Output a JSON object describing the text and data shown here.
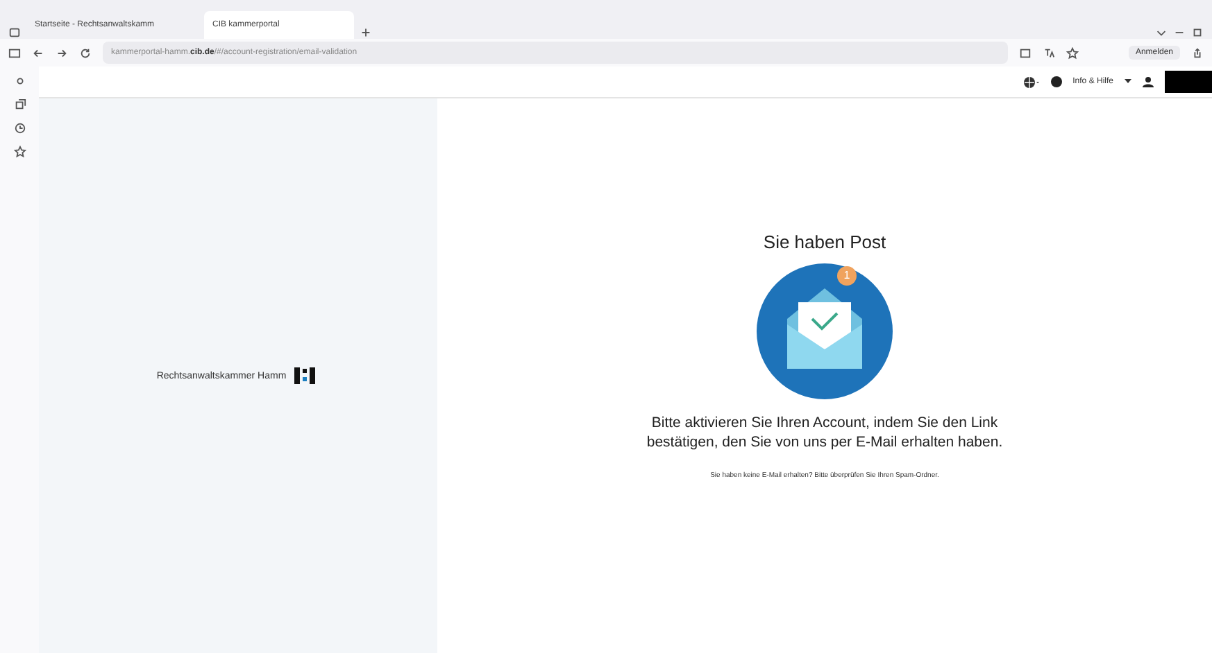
{
  "browser": {
    "tabs": [
      {
        "label": "Startseite - Rechtsanwaltskamm",
        "selected": false
      },
      {
        "label": "CIB kammerportal",
        "selected": true
      }
    ],
    "url": {
      "prefix": "kammerportal-hamm.",
      "domain": "cib.de",
      "path": "/#/account-registration/email-validation"
    },
    "sign_in": "Anmelden"
  },
  "header": {
    "help": "Info & Hilfe"
  },
  "brand": {
    "name": "Rechtsanwaltskammer Hamm"
  },
  "message": {
    "title": "Sie haben Post",
    "badge": "1",
    "body": "Bitte aktivieren Sie Ihren Account, indem Sie den Link bestätigen, den Sie von uns per E-Mail erhalten haben.",
    "hint": "Sie haben keine E-Mail erhalten? Bitte überprüfen Sie Ihren Spam-Ordner."
  }
}
